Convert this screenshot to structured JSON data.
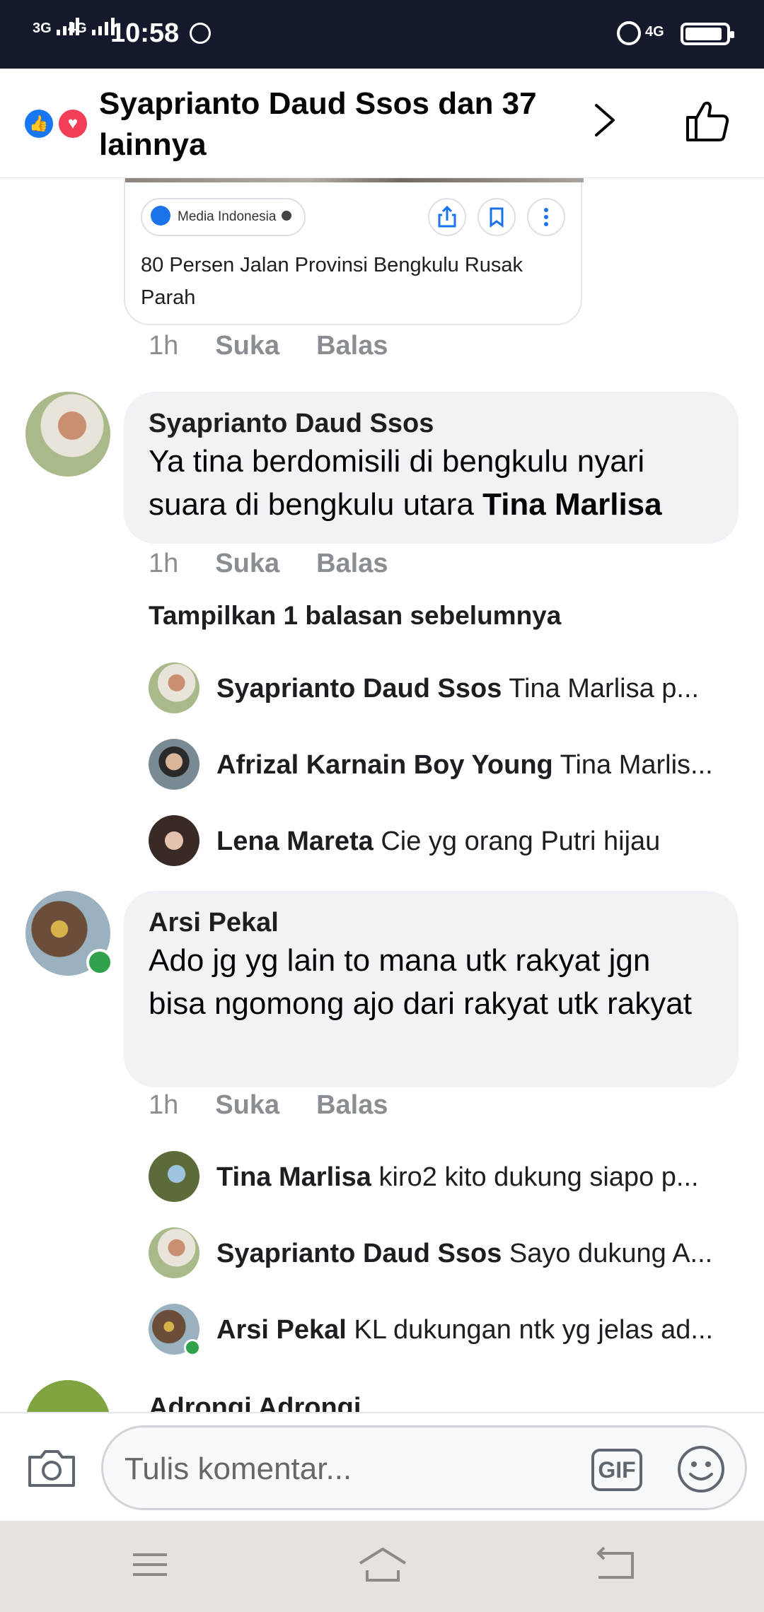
{
  "status_bar": {
    "signal1": "3G",
    "signal2": "4G",
    "time": "10:58",
    "network": "4G"
  },
  "header": {
    "title": "Syaprianto Daud Ssos dan 37 lainnya"
  },
  "link_card": {
    "source": "Media Indonesia",
    "title": "80 Persen Jalan Provinsi Bengkulu Rusak Parah"
  },
  "actions": {
    "time": "1h",
    "like": "Suka",
    "reply": "Balas"
  },
  "comments": [
    {
      "name": "Syaprianto Daud Ssos",
      "text": "Ya tina berdomisili di bengkulu nyari suara di bengkulu utara ",
      "mention": "Tina Marlisa"
    },
    {
      "name": "Arsi Pekal",
      "text": "Ado jg yg lain to mana utk rakyat jgn bisa ngomong ajo dari rakyat utk rakyat"
    },
    {
      "name": "Adrongi Adrongi"
    }
  ],
  "show_previous": "Tampilkan 1 balasan sebelumnya",
  "replies_1": [
    {
      "name": "Syaprianto Daud Ssos",
      "text": "Tina Marlisa  p..."
    },
    {
      "name": "Afrizal Karnain Boy Young",
      "text": "Tina Marlis..."
    },
    {
      "name": "Lena Mareta",
      "text": "Cie yg orang Putri hijau"
    }
  ],
  "replies_2": [
    {
      "name": "Tina Marlisa",
      "text": "kiro2 kito dukung siapo p..."
    },
    {
      "name": "Syaprianto Daud Ssos",
      "text": "Sayo dukung A..."
    },
    {
      "name": "Arsi Pekal",
      "text": "KL dukungan ntk yg jelas ad..."
    }
  ],
  "composer": {
    "placeholder": "Tulis komentar...",
    "gif": "GIF"
  }
}
